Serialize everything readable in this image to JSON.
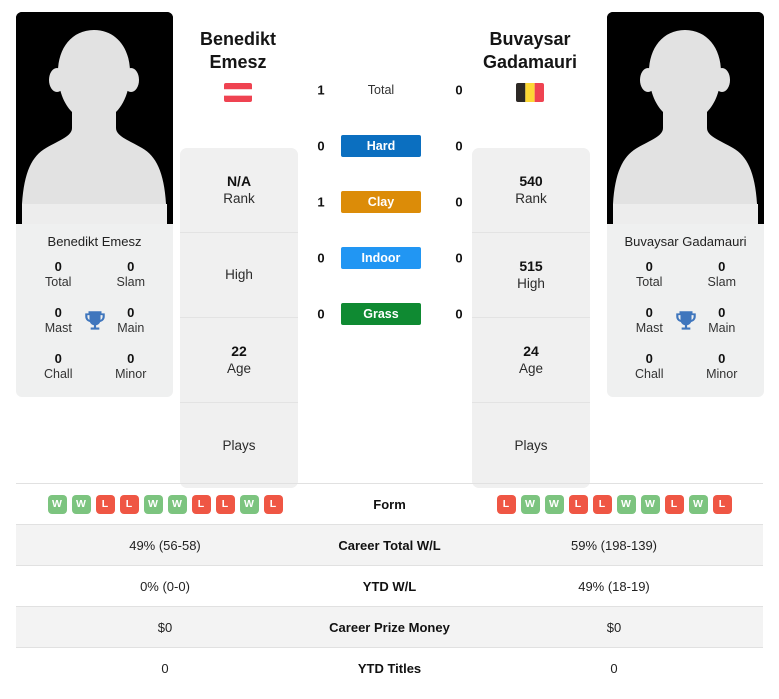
{
  "players": {
    "left": {
      "first_name": "Benedikt",
      "last_name": "Emesz",
      "full_name": "Benedikt Emesz",
      "country": "Austria",
      "flag": "austria-flag",
      "avatar": "player-silhouette-avatar",
      "trophies": [
        {
          "value": "0",
          "label": "Total"
        },
        {
          "value": "0",
          "label": "Slam"
        },
        {
          "value": "0",
          "label": "Mast"
        },
        {
          "value": "0",
          "label": "Main"
        },
        {
          "value": "0",
          "label": "Chall"
        },
        {
          "value": "0",
          "label": "Minor"
        }
      ],
      "strip": [
        {
          "value": "N/A",
          "label": "Rank"
        },
        {
          "value": "",
          "label": "High"
        },
        {
          "value": "22",
          "label": "Age"
        },
        {
          "value": "",
          "label": "Plays"
        }
      ],
      "form": [
        "W",
        "W",
        "L",
        "L",
        "W",
        "W",
        "L",
        "L",
        "W",
        "L"
      ],
      "career_total_wl": "49% (56-58)",
      "ytd_wl": "0% (0-0)",
      "career_prize_money": "$0",
      "ytd_titles": "0"
    },
    "right": {
      "first_name": "Buvaysar",
      "last_name": "Gadamauri",
      "full_name": "Buvaysar Gadamauri",
      "country": "Belgium",
      "flag": "belgium-flag",
      "avatar": "player-silhouette-avatar",
      "trophies": [
        {
          "value": "0",
          "label": "Total"
        },
        {
          "value": "0",
          "label": "Slam"
        },
        {
          "value": "0",
          "label": "Mast"
        },
        {
          "value": "0",
          "label": "Main"
        },
        {
          "value": "0",
          "label": "Chall"
        },
        {
          "value": "0",
          "label": "Minor"
        }
      ],
      "strip": [
        {
          "value": "540",
          "label": "Rank"
        },
        {
          "value": "515",
          "label": "High"
        },
        {
          "value": "24",
          "label": "Age"
        },
        {
          "value": "",
          "label": "Plays"
        }
      ],
      "form": [
        "L",
        "W",
        "W",
        "L",
        "L",
        "W",
        "W",
        "L",
        "W",
        "L"
      ],
      "career_total_wl": "59% (198-139)",
      "ytd_wl": "49% (18-19)",
      "career_prize_money": "$0",
      "ytd_titles": "0"
    }
  },
  "head_to_head": {
    "rows": [
      {
        "label": "Total",
        "left": "1",
        "right": "0",
        "bar": false,
        "color": ""
      },
      {
        "label": "Hard",
        "left": "0",
        "right": "0",
        "bar": true,
        "color": "#0b6fc0"
      },
      {
        "label": "Clay",
        "left": "1",
        "right": "0",
        "bar": true,
        "color": "#dc8c08"
      },
      {
        "label": "Indoor",
        "left": "0",
        "right": "0",
        "bar": true,
        "color": "#2196f3"
      },
      {
        "label": "Grass",
        "left": "0",
        "right": "0",
        "bar": true,
        "color": "#0f8a32"
      }
    ]
  },
  "comparison_table": {
    "rows": [
      {
        "label": "Form",
        "type": "form",
        "left": "",
        "right": ""
      },
      {
        "label": "Career Total W/L",
        "type": "text",
        "left": "49% (56-58)",
        "right": "59% (198-139)"
      },
      {
        "label": "YTD W/L",
        "type": "text",
        "left": "0% (0-0)",
        "right": "49% (18-19)"
      },
      {
        "label": "Career Prize Money",
        "type": "text",
        "left": "$0",
        "right": "$0"
      },
      {
        "label": "YTD Titles",
        "type": "text",
        "left": "0",
        "right": "0"
      }
    ]
  },
  "colors": {
    "hard": "#0b6fc0",
    "clay": "#dc8c08",
    "indoor": "#2196f3",
    "grass": "#0f8a32",
    "win_badge": "#7cc47f",
    "loss_badge": "#ef5644",
    "card_bg": "#eff0f0",
    "row_shade": "#f3f3f3"
  }
}
